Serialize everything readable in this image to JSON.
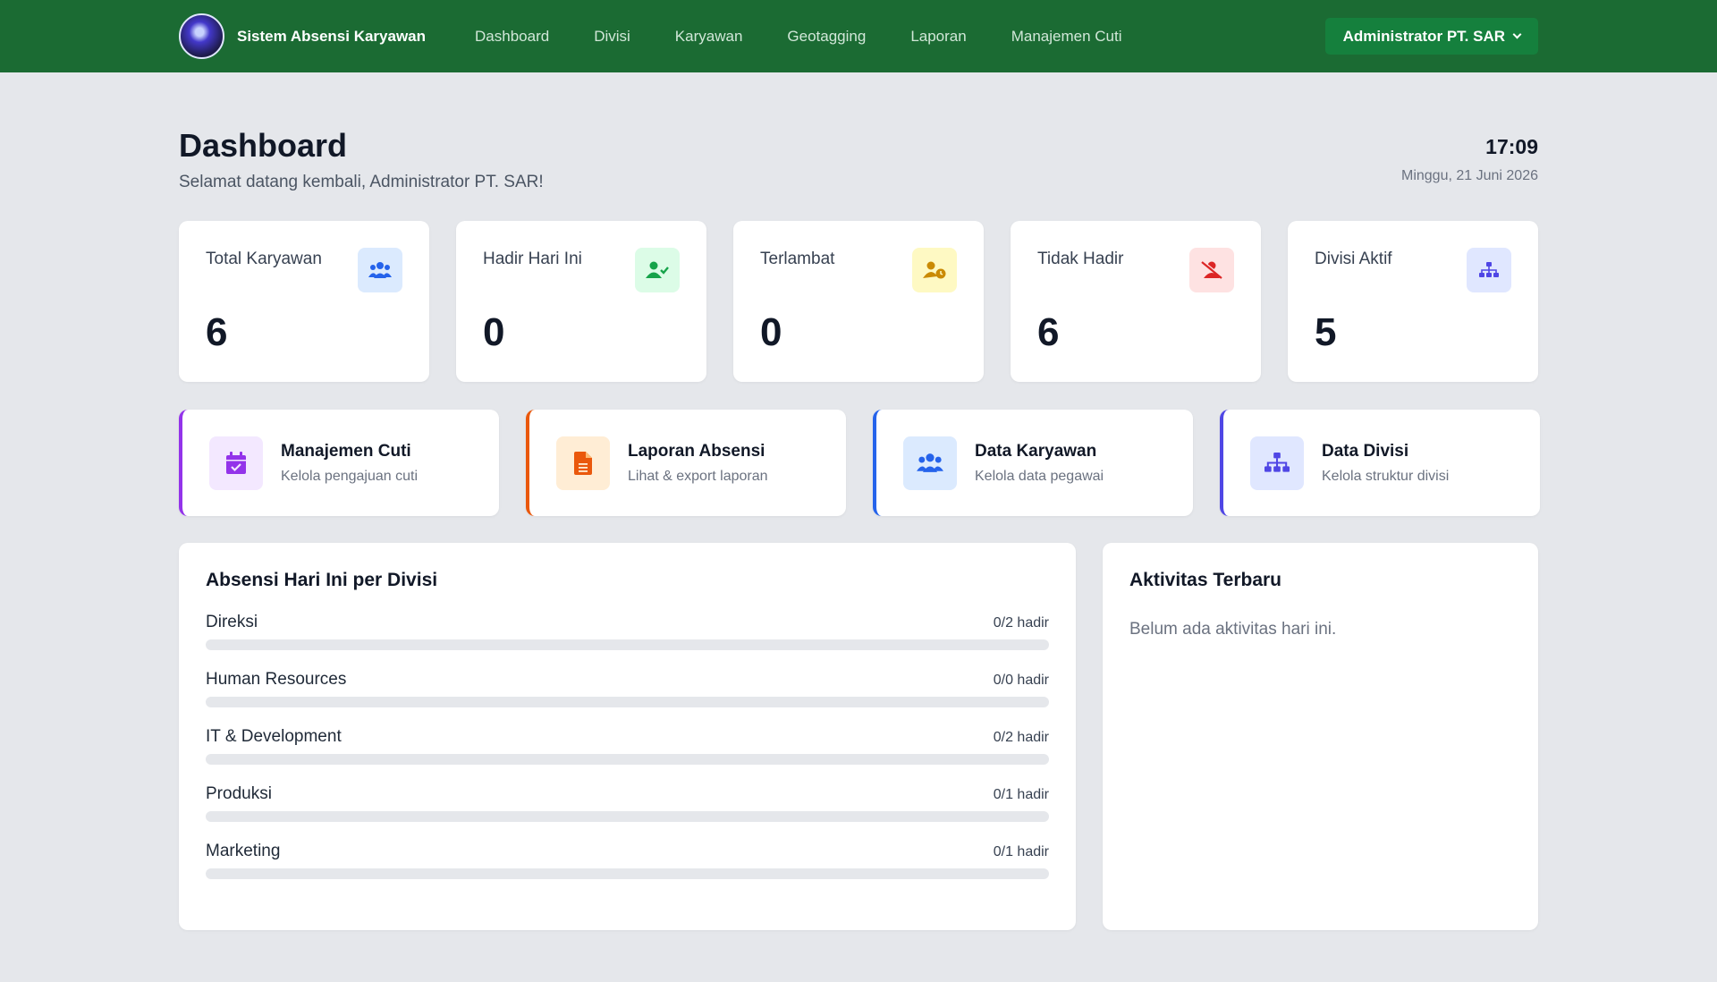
{
  "nav": {
    "brand": "Sistem Absensi Karyawan",
    "links": [
      "Dashboard",
      "Divisi",
      "Karyawan",
      "Geotagging",
      "Laporan",
      "Manajemen Cuti"
    ],
    "user": "Administrator PT. SAR"
  },
  "header": {
    "title": "Dashboard",
    "subtitle": "Selamat datang kembali, Administrator PT. SAR!",
    "time": "17:09",
    "date": "Minggu, 21 Juni 2026"
  },
  "stats": [
    {
      "label": "Total Karyawan",
      "value": "6",
      "icon": "users-icon",
      "color": "#2563eb",
      "bg": "#dbeafe"
    },
    {
      "label": "Hadir Hari Ini",
      "value": "0",
      "icon": "user-check-icon",
      "color": "#16a34a",
      "bg": "#dcfce7"
    },
    {
      "label": "Terlambat",
      "value": "0",
      "icon": "user-clock-icon",
      "color": "#ca8a04",
      "bg": "#fef9c3"
    },
    {
      "label": "Tidak Hadir",
      "value": "6",
      "icon": "user-slash-icon",
      "color": "#dc2626",
      "bg": "#fee2e2"
    },
    {
      "label": "Divisi Aktif",
      "value": "5",
      "icon": "sitemap-icon",
      "color": "#4f46e5",
      "bg": "#e0e7ff"
    }
  ],
  "quick_links": [
    {
      "title": "Manajemen Cuti",
      "subtitle": "Kelola pengajuan cuti",
      "icon": "calendar-check-icon",
      "color": "#9333ea",
      "bg": "#f3e8ff"
    },
    {
      "title": "Laporan Absensi",
      "subtitle": "Lihat & export laporan",
      "icon": "file-icon",
      "color": "#ea580c",
      "bg": "#ffedd5"
    },
    {
      "title": "Data Karyawan",
      "subtitle": "Kelola data pegawai",
      "icon": "users-icon",
      "color": "#2563eb",
      "bg": "#dbeafe"
    },
    {
      "title": "Data Divisi",
      "subtitle": "Kelola struktur divisi",
      "icon": "sitemap-icon",
      "color": "#4f46e5",
      "bg": "#e0e7ff"
    }
  ],
  "attendance": {
    "title": "Absensi Hari Ini per Divisi",
    "divisions": [
      {
        "name": "Direksi",
        "count": "0/2 hadir",
        "fraction": 0
      },
      {
        "name": "Human Resources",
        "count": "0/0 hadir",
        "fraction": 0
      },
      {
        "name": "IT & Development",
        "count": "0/2 hadir",
        "fraction": 0
      },
      {
        "name": "Produksi",
        "count": "0/1 hadir",
        "fraction": 0
      },
      {
        "name": "Marketing",
        "count": "0/1 hadir",
        "fraction": 0
      }
    ]
  },
  "activity": {
    "title": "Aktivitas Terbaru",
    "empty": "Belum ada aktivitas hari ini."
  }
}
